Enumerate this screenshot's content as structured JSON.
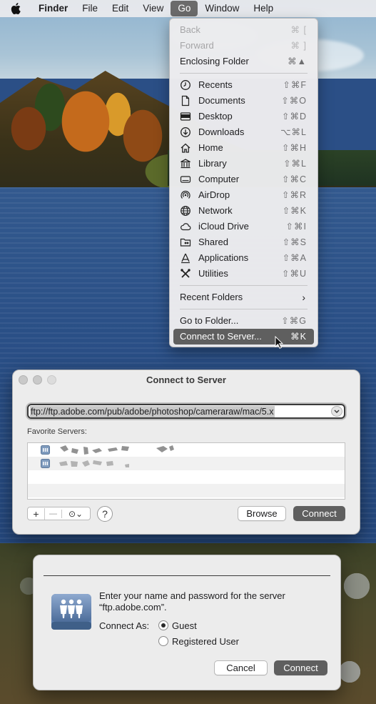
{
  "menubar": {
    "apple_icon": "apple-logo-icon",
    "items": [
      "Finder",
      "File",
      "Edit",
      "View",
      "Go",
      "Window",
      "Help"
    ],
    "active_item": "Go"
  },
  "go_menu": {
    "top": [
      {
        "label": "Back",
        "shortcut": "⌘ [",
        "enabled": false
      },
      {
        "label": "Forward",
        "shortcut": "⌘ ]",
        "enabled": false
      },
      {
        "label": "Enclosing Folder",
        "shortcut": "⌘▲",
        "enabled": true
      }
    ],
    "places": [
      {
        "label": "Recents",
        "shortcut": "⇧⌘F",
        "icon": "clock-icon"
      },
      {
        "label": "Documents",
        "shortcut": "⇧⌘O",
        "icon": "document-icon"
      },
      {
        "label": "Desktop",
        "shortcut": "⇧⌘D",
        "icon": "desktop-icon"
      },
      {
        "label": "Downloads",
        "shortcut": "⌥⌘L",
        "icon": "download-icon"
      },
      {
        "label": "Home",
        "shortcut": "⇧⌘H",
        "icon": "home-icon"
      },
      {
        "label": "Library",
        "shortcut": "⇧⌘L",
        "icon": "library-icon"
      },
      {
        "label": "Computer",
        "shortcut": "⇧⌘C",
        "icon": "computer-icon"
      },
      {
        "label": "AirDrop",
        "shortcut": "⇧⌘R",
        "icon": "airdrop-icon"
      },
      {
        "label": "Network",
        "shortcut": "⇧⌘K",
        "icon": "globe-icon"
      },
      {
        "label": "iCloud Drive",
        "shortcut": "⇧⌘I",
        "icon": "cloud-icon"
      },
      {
        "label": "Shared",
        "shortcut": "⇧⌘S",
        "icon": "shared-folder-icon"
      },
      {
        "label": "Applications",
        "shortcut": "⇧⌘A",
        "icon": "applications-icon"
      },
      {
        "label": "Utilities",
        "shortcut": "⇧⌘U",
        "icon": "utilities-icon"
      }
    ],
    "recent_folders": "Recent Folders",
    "go_to_folder": {
      "label": "Go to Folder...",
      "shortcut": "⇧⌘G"
    },
    "connect_to_server": {
      "label": "Connect to Server...",
      "shortcut": "⌘K"
    }
  },
  "connect_window": {
    "title": "Connect to Server",
    "url_value": "ftp://ftp.adobe.com/pub/adobe/photoshop/cameraraw/mac/5.x",
    "favorites_label": "Favorite Servers:",
    "segment": {
      "add": "+",
      "remove": "—",
      "more": "⊙⌄"
    },
    "help": "?",
    "browse_label": "Browse",
    "connect_label": "Connect"
  },
  "login_sheet": {
    "prompt_line1": "Enter your name and password for the server",
    "prompt_line2": "“ftp.adobe.com”.",
    "connect_as_label": "Connect As:",
    "options": [
      "Guest",
      "Registered User"
    ],
    "selected_option": "Guest",
    "cancel_label": "Cancel",
    "connect_label": "Connect"
  }
}
